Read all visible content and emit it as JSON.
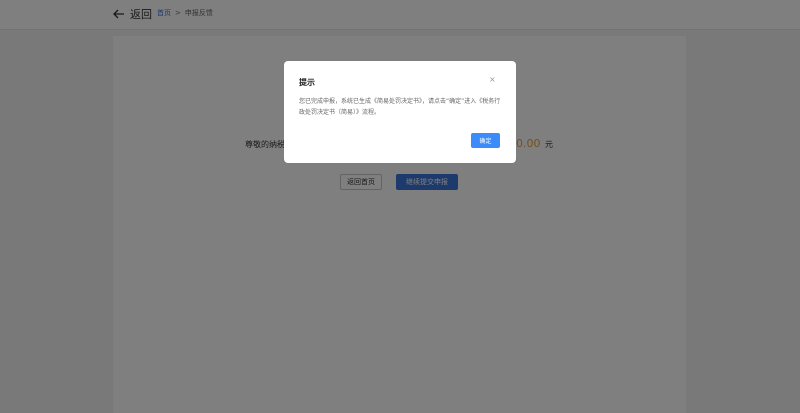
{
  "header": {
    "back_label": "返回",
    "breadcrumb": {
      "home": "首页",
      "separator": ">",
      "current": "申报反馈"
    }
  },
  "main": {
    "notice_text": "尊敬的纳税",
    "amount": "0.00",
    "unit": "元",
    "return_button": "返回首页",
    "next_button": "继续提交申报"
  },
  "dialog": {
    "title": "提示",
    "close": "×",
    "message": "您已完成申报，系统已生成《简易处罚决定书》，请点击“确定”进入《税务行政处罚决定书（简易）》流程。",
    "confirm": "确定"
  },
  "colors": {
    "accent": "#3b74d9",
    "amount": "#e6a23c",
    "dialog_button": "#3b8bfa"
  }
}
